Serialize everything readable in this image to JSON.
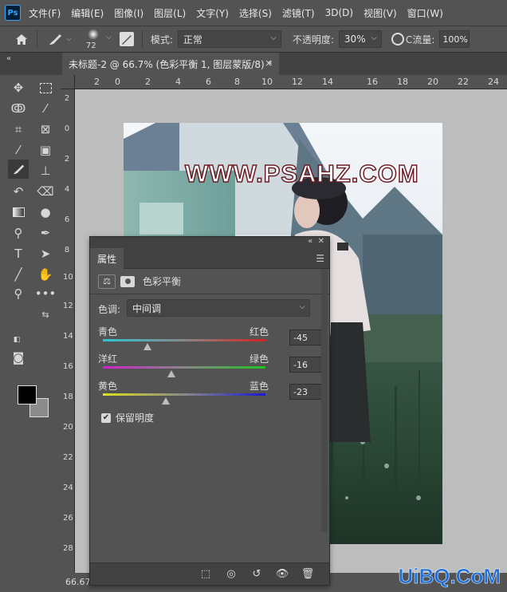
{
  "app": {
    "logo": "Ps"
  },
  "menu": [
    "文件(F)",
    "编辑(E)",
    "图像(I)",
    "图层(L)",
    "文字(Y)",
    "选择(S)",
    "滤镜(T)",
    "3D(D)",
    "视图(V)",
    "窗口(W)"
  ],
  "options": {
    "brush_size": "72",
    "mode_label": "模式:",
    "mode_value": "正常",
    "opacity_label": "不透明度:",
    "opacity_value": "30%",
    "flow_label": "流量:",
    "flow_value": "100%"
  },
  "document": {
    "tab_title": "未标题-2 @ 66.7% (色彩平衡 1, 图层蒙版/8) *",
    "close": "×",
    "zoom_status": "66.67%",
    "watermark": "WWW.PSAHZ.COM",
    "corner_logo": "UiBQ.CoM"
  },
  "ruler_h": [
    "2",
    "0",
    "2",
    "4",
    "6",
    "8",
    "10",
    "12",
    "14",
    "16",
    "18",
    "20",
    "22",
    "24"
  ],
  "ruler_v": [
    "2",
    "0",
    "2",
    "4",
    "6",
    "8",
    "10",
    "12",
    "14",
    "16",
    "18",
    "20",
    "22",
    "24",
    "26",
    "28"
  ],
  "properties": {
    "tab": "属性",
    "adjustment_title": "色彩平衡",
    "tone_label": "色调:",
    "tone_value": "中间调",
    "sliders": [
      {
        "left": "青色",
        "right": "红色",
        "value": "-45",
        "level": -45
      },
      {
        "left": "洋红",
        "right": "绿色",
        "value": "-16",
        "level": -16
      },
      {
        "left": "黄色",
        "right": "蓝色",
        "value": "-23",
        "level": -23
      }
    ],
    "preserve_label": "保留明度"
  },
  "colors": {
    "cyan": "#2ec4d4",
    "red": "#d62020",
    "magenta": "#d020d0",
    "green": "#20c020",
    "yellow": "#e0e020",
    "blue": "#1a1ad0"
  }
}
